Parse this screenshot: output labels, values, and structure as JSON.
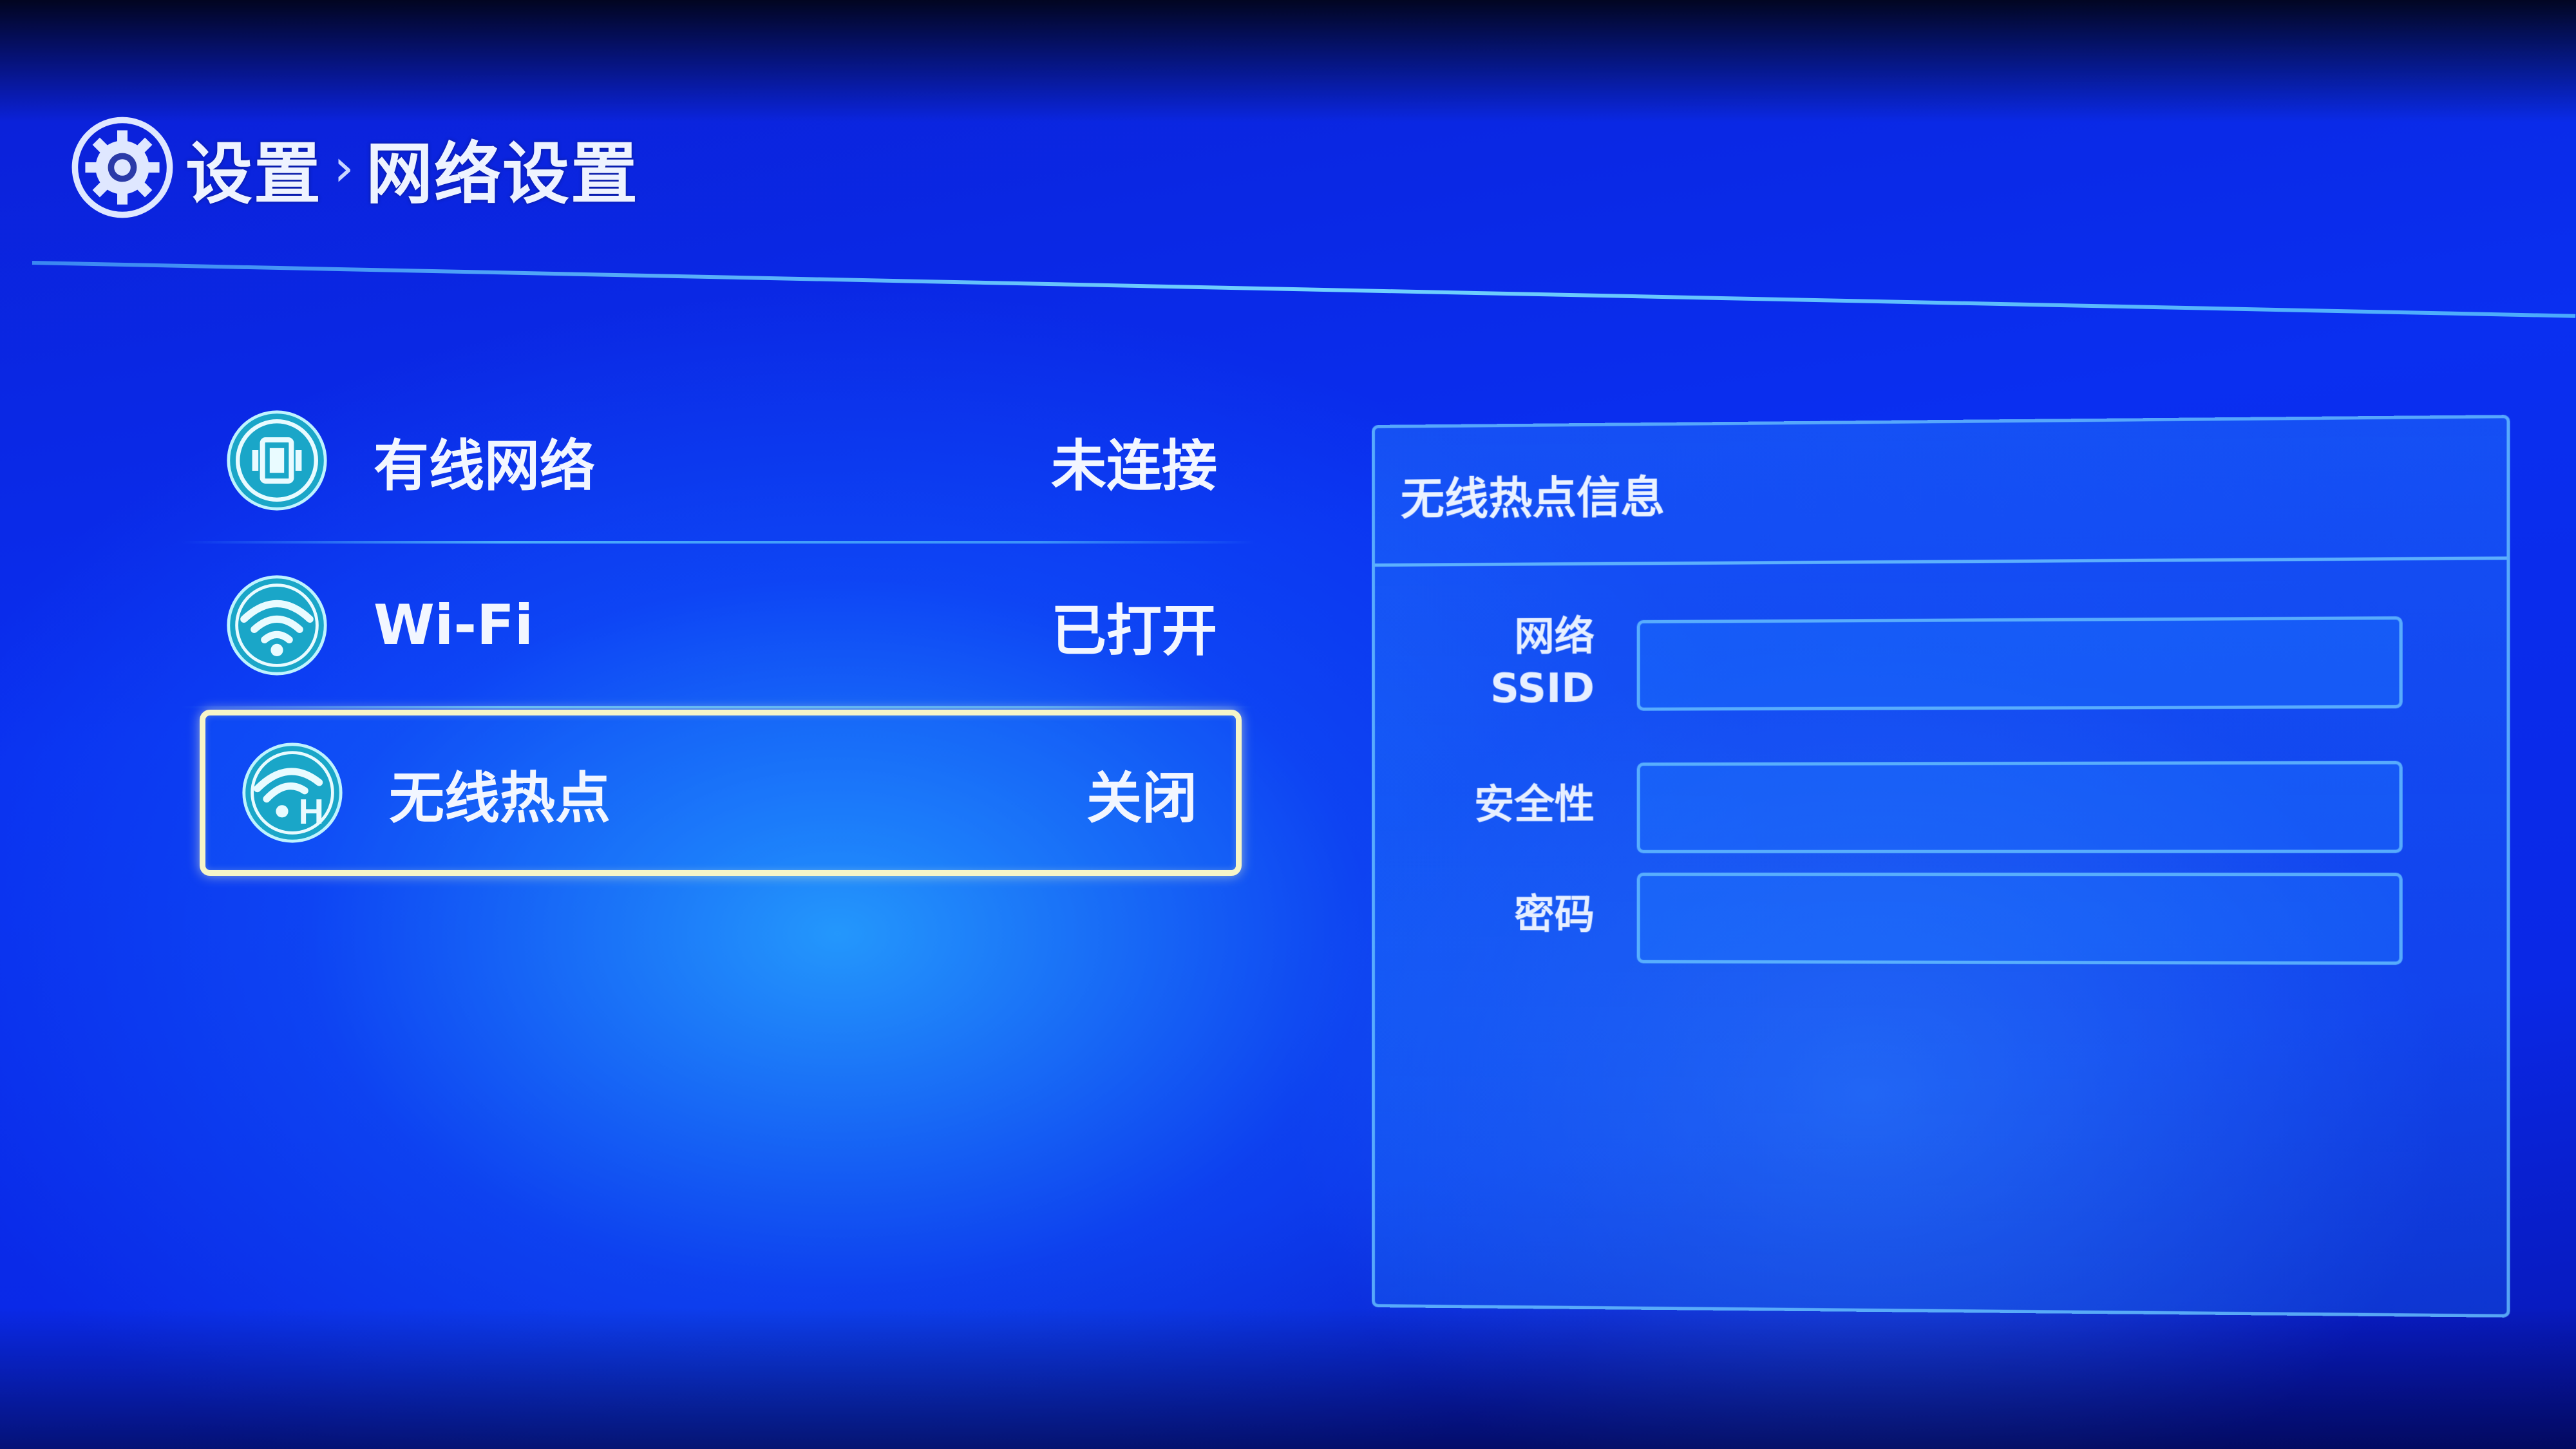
{
  "header": {
    "breadcrumb_root": "设置",
    "separator": "›",
    "breadcrumb_current": "网络设置"
  },
  "menu": {
    "items": [
      {
        "label": "有线网络",
        "value": "未连接",
        "icon": "ethernet-icon"
      },
      {
        "label": "Wi-Fi",
        "value": "已打开",
        "icon": "wifi-icon"
      },
      {
        "label": "无线热点",
        "value": "关闭",
        "icon": "hotspot-icon",
        "selected": true
      }
    ]
  },
  "panel": {
    "title": "无线热点信息",
    "fields": [
      {
        "label_line1": "网络",
        "label_line2": "SSID",
        "value": ""
      },
      {
        "label_line1": "安全性",
        "label_line2": "",
        "value": ""
      },
      {
        "label_line1": "密码",
        "label_line2": "",
        "value": ""
      }
    ]
  },
  "colors": {
    "background": "#0a2ff0",
    "accent_line": "#6ec8ff",
    "selection_border": "#f6f5c8",
    "icon_fill": "#1aa6c8",
    "text": "#f2f6ff"
  }
}
